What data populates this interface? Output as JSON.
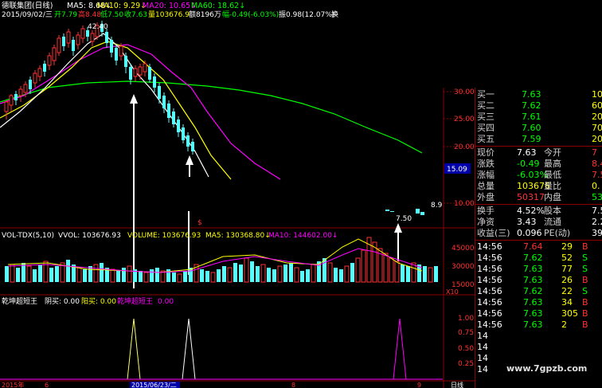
{
  "main_header": {
    "stock": "德联集团(日线)",
    "ma5": "MA5: 8.68↓",
    "ma10": "MA10: 9.29↓",
    "ma20": "MA20: 10.65↓",
    "ma60": "MA60: 18.62↓",
    "info_date": "2015/09/02/三",
    "info_open": "开7.79",
    "info_high": "高8.48",
    "info_low": "低7.50",
    "info_close": "收7.63",
    "info_vol": "量103676.9",
    "info_amt": "额8196万",
    "info_chg": "幅-0.49(-6.03%)",
    "info_amp": "振0.98(12.07%)",
    "info_more": "换"
  },
  "vol_header": {
    "name": "VOL-TDX(5,10)",
    "vvol": "VVOL: 103676.93",
    "volume": "VOLUME: 103676.93",
    "ma5": "MA5: 130368.80↓",
    "ma10": "MA10: 144602.00↓"
  },
  "ind_header": {
    "name": "乾坤超短王",
    "yin": "阴买: 0.00",
    "yang": "阳买: 0.00",
    "name2": "乾坤超短王",
    "val": "0.00"
  },
  "price_axis": [
    "30.00",
    "25.00",
    "20.00",
    "15.09",
    "10.00"
  ],
  "vol_axis": [
    "45000",
    "30000",
    "15000",
    "X10"
  ],
  "ind_axis": [
    "1.00",
    "0.75",
    "0.50",
    "0.25"
  ],
  "date_axis": [
    "2015年",
    "6",
    "2015/06/23/二",
    "8",
    "9"
  ],
  "labels": {
    "high_mark": "42.40",
    "low_mark": "7.50",
    "right_mark": "8.9",
    "dollar": "$",
    "date_right": "日线"
  },
  "watermark": "www.7gpzb.com",
  "quote": {
    "bids": [
      {
        "label": "买一",
        "price": "7.63",
        "vol": "104"
      },
      {
        "label": "买二",
        "price": "7.62",
        "vol": "60"
      },
      {
        "label": "买三",
        "price": "7.61",
        "vol": "20"
      },
      {
        "label": "买四",
        "price": "7.60",
        "vol": "70"
      },
      {
        "label": "买五",
        "price": "7.59",
        "vol": "20"
      }
    ],
    "stats": [
      {
        "l1": "现价",
        "v1": "7.63",
        "l2": "今开",
        "v2": "7"
      },
      {
        "l1": "涨跌",
        "v1": "-0.49",
        "l2": "最高",
        "v2": "8.4"
      },
      {
        "l1": "涨幅",
        "v1": "-6.03%",
        "l2": "最低",
        "v2": "7.5"
      },
      {
        "l1": "总量",
        "v1": "103676",
        "l2": "量比",
        "v2": "0."
      },
      {
        "l1": "外盘",
        "v1": "50317",
        "l2": "内盘",
        "v2": "5335"
      }
    ],
    "stats2": [
      {
        "l1": "换手",
        "v1": "4.52%",
        "l2": "股本",
        "v2": "7.54"
      },
      {
        "l1": "净资",
        "v1": "3.43",
        "l2": "流通",
        "v2": "2.29"
      },
      {
        "l1": "收益(三)",
        "v1": "0.096",
        "l2": "PE(动)",
        "v2": "39"
      }
    ],
    "ticks": [
      {
        "time": "14:56",
        "price": "7.64",
        "vol": "29",
        "side": "B"
      },
      {
        "time": "14:56",
        "price": "7.62",
        "vol": "52",
        "side": "S"
      },
      {
        "time": "14:56",
        "price": "7.63",
        "vol": "77",
        "side": "S"
      },
      {
        "time": "14:56",
        "price": "7.63",
        "vol": "26",
        "side": "B"
      },
      {
        "time": "14:56",
        "price": "7.62",
        "vol": "22",
        "side": "S"
      },
      {
        "time": "14:56",
        "price": "7.63",
        "vol": "34",
        "side": "B"
      },
      {
        "time": "14:56",
        "price": "7.63",
        "vol": "305",
        "side": "B"
      },
      {
        "time": "14:56",
        "price": "7.63",
        "vol": "2",
        "side": "B"
      }
    ]
  },
  "colors": {
    "bg": "#000000",
    "grid": "#8b0000",
    "up": "#ff3232",
    "down": "#54ffff",
    "ma5": "#ffffff",
    "ma10": "#ffff00",
    "ma20": "#ff00ff",
    "ma60": "#00ff00",
    "value": "#00ff00"
  }
}
